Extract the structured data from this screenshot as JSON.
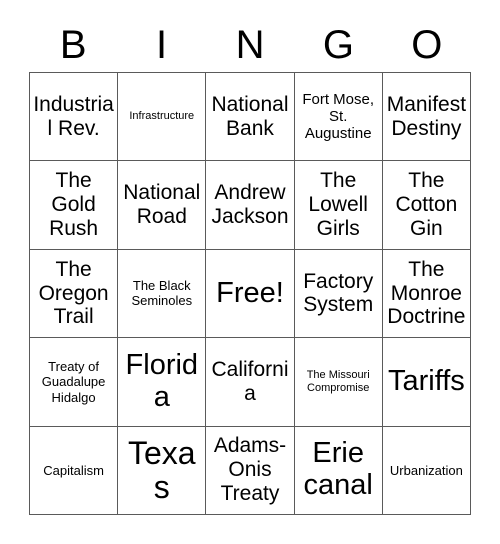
{
  "card": {
    "title": "BINGO",
    "header_letters": [
      "B",
      "I",
      "N",
      "G",
      "O"
    ],
    "columns": 5,
    "rows": 5,
    "free_space_label": "Free!",
    "colors": {
      "background": "#ffffff",
      "text": "#000000",
      "grid_line": "#5a5a5a"
    }
  },
  "cells": [
    {
      "text": "Industrial Rev.",
      "size": "l"
    },
    {
      "text": "Infrastructure",
      "size": "xs"
    },
    {
      "text": "National Bank",
      "size": "l"
    },
    {
      "text": "Fort Mose, St. Augustine",
      "size": "m"
    },
    {
      "text": "Manifest Destiny",
      "size": "l"
    },
    {
      "text": "The Gold Rush",
      "size": "l"
    },
    {
      "text": "National Road",
      "size": "l"
    },
    {
      "text": "Andrew Jackson",
      "size": "l"
    },
    {
      "text": "The Lowell Girls",
      "size": "l"
    },
    {
      "text": "The Cotton Gin",
      "size": "l"
    },
    {
      "text": "The Oregon Trail",
      "size": "l"
    },
    {
      "text": "The Black Seminoles",
      "size": "s"
    },
    {
      "text": "Free!",
      "size": "xxl"
    },
    {
      "text": "Factory System",
      "size": "l"
    },
    {
      "text": "The Monroe Doctrine",
      "size": "l"
    },
    {
      "text": "Treaty of Guadalupe Hidalgo",
      "size": "s"
    },
    {
      "text": "Florida",
      "size": "xxl"
    },
    {
      "text": "California",
      "size": "l"
    },
    {
      "text": "The Missouri Compromise",
      "size": "xs"
    },
    {
      "text": "Tariffs",
      "size": "xxl"
    },
    {
      "text": "Capitalism",
      "size": "s"
    },
    {
      "text": "Texas",
      "size": "huge"
    },
    {
      "text": "Adams-Onis Treaty",
      "size": "l"
    },
    {
      "text": "Erie canal",
      "size": "xxl"
    },
    {
      "text": "Urbanization",
      "size": "s"
    }
  ]
}
